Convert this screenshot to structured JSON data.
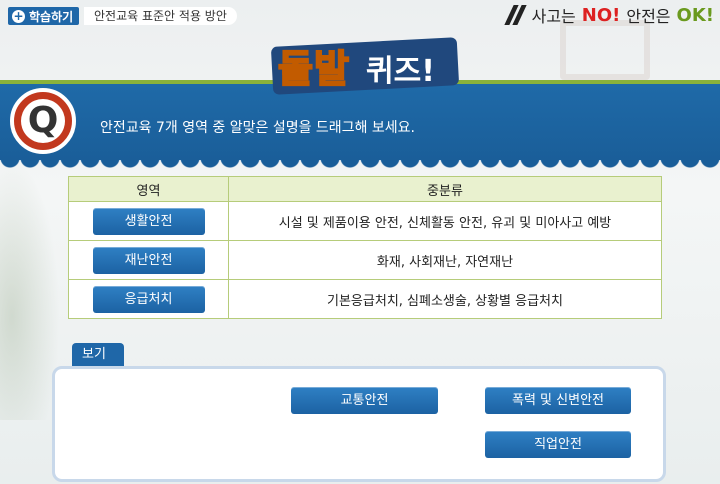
{
  "header": {
    "learn_label": "학습하기",
    "breadcrumb": "안전교육 표준안 적용 방안",
    "slogan_part1": "사고는",
    "slogan_no": "NO!",
    "slogan_part2": "안전은",
    "slogan_ok": "OK!"
  },
  "title": {
    "part1": "돌발",
    "part2": "퀴즈!"
  },
  "question": {
    "icon_letter": "Q",
    "text": "안전교육 7개 영역 중 알맞은 설명을 드래그해 보세요."
  },
  "table": {
    "headers": [
      "영역",
      "중분류"
    ],
    "rows": [
      {
        "area": "생활안전",
        "desc": "시설 및 제품이용 안전, 신체활동 안전, 유괴 및 미아사고 예방"
      },
      {
        "area": "재난안전",
        "desc": "화재, 사회재난, 자연재난"
      },
      {
        "area": "응급처치",
        "desc": "기본응급처치, 심폐소생술, 상황별 응급처치"
      }
    ]
  },
  "bogi": {
    "label": "보기",
    "choices": [
      "교통안전",
      "폭력 및 신변안전",
      "직업안전"
    ]
  },
  "colors": {
    "primary_blue": "#1f67a8",
    "accent_green": "#8ab23a",
    "no_red": "#dd2222",
    "ok_green": "#6a9a1e"
  }
}
